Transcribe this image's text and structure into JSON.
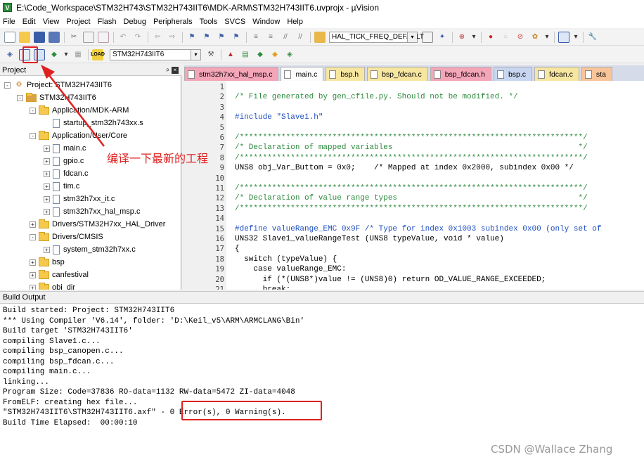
{
  "window": {
    "title": "E:\\Code_Workspace\\STM32H743\\STM32H743IIT6\\MDK-ARM\\STM32H743IIT6.uvprojx - µVision"
  },
  "menu": [
    "File",
    "Edit",
    "View",
    "Project",
    "Flash",
    "Debug",
    "Peripherals",
    "Tools",
    "SVCS",
    "Window",
    "Help"
  ],
  "toolbar1": {
    "define_dropdown": "HAL_TICK_FREQ_DEFAULT"
  },
  "toolbar2": {
    "target_dropdown": "STM32H743IIT6"
  },
  "project_panel": {
    "title": "Project",
    "tree": [
      {
        "label": "Project: STM32H743IIT6",
        "level": 0,
        "kind": "root",
        "expander": "-"
      },
      {
        "label": "STM32H743IIT6",
        "level": 1,
        "kind": "target",
        "expander": "-"
      },
      {
        "label": "Application/MDK-ARM",
        "level": 2,
        "kind": "folder",
        "expander": "-"
      },
      {
        "label": "startup_stm32h743xx.s",
        "level": 3,
        "kind": "file",
        "expander": ""
      },
      {
        "label": "Application/User/Core",
        "level": 2,
        "kind": "folder",
        "expander": "-"
      },
      {
        "label": "main.c",
        "level": 3,
        "kind": "file",
        "expander": "+"
      },
      {
        "label": "gpio.c",
        "level": 3,
        "kind": "file",
        "expander": "+"
      },
      {
        "label": "fdcan.c",
        "level": 3,
        "kind": "file",
        "expander": "+"
      },
      {
        "label": "tim.c",
        "level": 3,
        "kind": "file",
        "expander": "+"
      },
      {
        "label": "stm32h7xx_it.c",
        "level": 3,
        "kind": "file",
        "expander": "+"
      },
      {
        "label": "stm32h7xx_hal_msp.c",
        "level": 3,
        "kind": "file",
        "expander": "+"
      },
      {
        "label": "Drivers/STM32H7xx_HAL_Driver",
        "level": 2,
        "kind": "folder",
        "expander": "+"
      },
      {
        "label": "Drivers/CMSIS",
        "level": 2,
        "kind": "folder",
        "expander": "-"
      },
      {
        "label": "system_stm32h7xx.c",
        "level": 3,
        "kind": "file",
        "expander": "+"
      },
      {
        "label": "bsp",
        "level": 2,
        "kind": "folder",
        "expander": "+"
      },
      {
        "label": "canfestival",
        "level": 2,
        "kind": "folder",
        "expander": "+"
      },
      {
        "label": "obj_dir",
        "level": 2,
        "kind": "folder",
        "expander": "+"
      }
    ]
  },
  "tabs": [
    {
      "label": "stm32h7xx_hal_msp.c",
      "color": "#f4a6b8"
    },
    {
      "label": "main.c",
      "color": "#fbfbfb"
    },
    {
      "label": "bsp.h",
      "color": "#f7e6a0"
    },
    {
      "label": "bsp_fdcan.c",
      "color": "#f7e6a0"
    },
    {
      "label": "bsp_fdcan.h",
      "color": "#f4a6b8"
    },
    {
      "label": "bsp.c",
      "color": "#c9d6f2"
    },
    {
      "label": "fdcan.c",
      "color": "#f7e6a0"
    },
    {
      "label": "sta",
      "color": "#f8c59a"
    }
  ],
  "editor": {
    "lines": [
      {
        "n": "1",
        "text": ""
      },
      {
        "n": "2",
        "text": "/* File generated by gen_cfile.py. Should not be modified. */"
      },
      {
        "n": "3",
        "text": ""
      },
      {
        "n": "4",
        "text": "#include \"Slave1.h\""
      },
      {
        "n": "5",
        "text": ""
      },
      {
        "n": "6",
        "text": "/**************************************************************************/"
      },
      {
        "n": "7",
        "text": "/* Declaration of mapped variables                                        */"
      },
      {
        "n": "8",
        "text": "/**************************************************************************/"
      },
      {
        "n": "9",
        "text": "UNS8 obj_Var_Buttom = 0x0;    /* Mapped at index 0x2000, subindex 0x00 */"
      },
      {
        "n": "10",
        "text": ""
      },
      {
        "n": "11",
        "text": "/**************************************************************************/"
      },
      {
        "n": "12",
        "text": "/* Declaration of value range types                                       */"
      },
      {
        "n": "13",
        "text": "/**************************************************************************/"
      },
      {
        "n": "14",
        "text": ""
      },
      {
        "n": "15",
        "text": "#define valueRange_EMC 0x9F /* Type for index 0x1003 subindex 0x00 (only set of"
      },
      {
        "n": "16",
        "text": "UNS32 Slave1_valueRangeTest (UNS8 typeValue, void * value)"
      },
      {
        "n": "17",
        "text": "{"
      },
      {
        "n": "18",
        "text": "  switch (typeValue) {"
      },
      {
        "n": "19",
        "text": "    case valueRange_EMC:"
      },
      {
        "n": "20",
        "text": "      if (*(UNS8*)value != (UNS8)0) return OD_VALUE_RANGE_EXCEEDED;"
      },
      {
        "n": "21",
        "text": "      break;"
      }
    ]
  },
  "build_output": {
    "title": "Build Output",
    "lines": [
      "Build started: Project: STM32H743IIT6",
      "*** Using Compiler 'V6.14', folder: 'D:\\Keil_v5\\ARM\\ARMCLANG\\Bin'",
      "Build target 'STM32H743IIT6'",
      "compiling Slave1.c...",
      "compiling bsp_canopen.c...",
      "compiling bsp_fdcan.c...",
      "compiling main.c...",
      "linking...",
      "Program Size: Code=37836 RO-data=1132 RW-data=5472 ZI-data=4048",
      "FromELF: creating hex file...",
      "\"STM32H743IIT6\\STM32H743IIT6.axf\" - 0 Error(s), 0 Warning(s).",
      "Build Time Elapsed:  00:00:10"
    ]
  },
  "annotation": {
    "text": "编译一下最新的工程",
    "color": "#e02020"
  },
  "watermark": "CSDN @Wallace Zhang"
}
